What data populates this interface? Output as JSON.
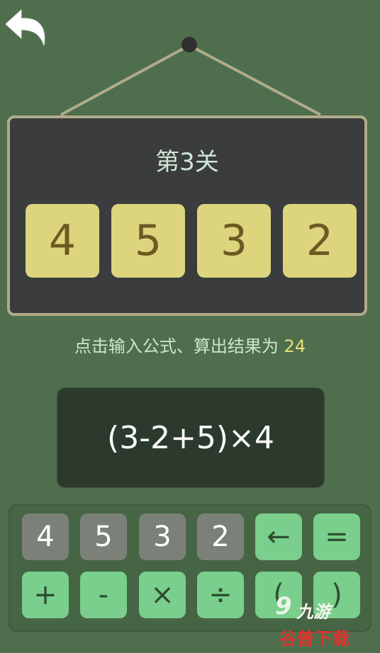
{
  "level": {
    "title": "第3关"
  },
  "cards": [
    "4",
    "5",
    "3",
    "2"
  ],
  "hint": {
    "text": "点击输入公式、算出结果为 ",
    "target": "24"
  },
  "formula": "(3-2+5)×4",
  "keypad": {
    "numbers": [
      "4",
      "5",
      "3",
      "2"
    ],
    "backspace": "←",
    "equals": "=",
    "plus": "+",
    "minus": "-",
    "times": "×",
    "divide": "÷",
    "lparen": "(",
    "rparen": ")"
  },
  "watermark": {
    "logo": "9",
    "brand": "九游",
    "sub": "谷普下载"
  },
  "colors": {
    "background": "#4f6e4d",
    "board": "#3a3c3d",
    "card": "#dcd57e",
    "number_key": "#7b8179",
    "operator_key": "#79cf8b",
    "target_value": "#e7e075"
  },
  "icons": {
    "back": "undo-arrow-icon"
  }
}
